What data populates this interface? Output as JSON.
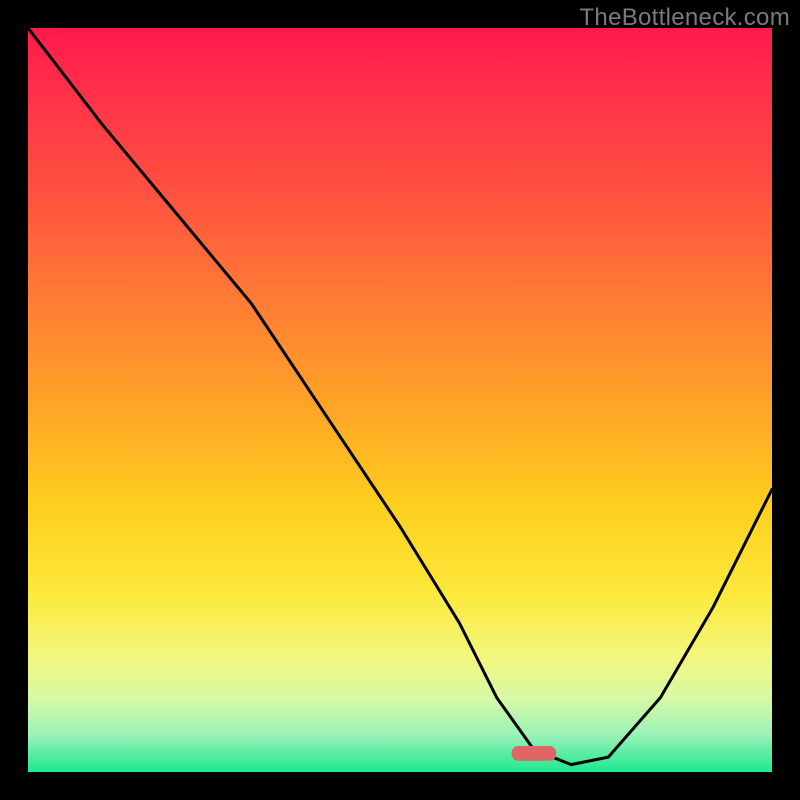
{
  "watermark": "TheBottleneck.com",
  "chart_data": {
    "type": "line",
    "title": "",
    "xlabel": "",
    "ylabel": "",
    "xlim": [
      0,
      100
    ],
    "ylim": [
      0,
      100
    ],
    "grid": false,
    "legend": false,
    "background_gradient": {
      "orientation": "vertical",
      "stops": [
        {
          "pos": 0,
          "color": "#ff1a4d"
        },
        {
          "pos": 50,
          "color": "#ffa228"
        },
        {
          "pos": 80,
          "color": "#f4f67a"
        },
        {
          "pos": 100,
          "color": "#1de890"
        }
      ]
    },
    "series": [
      {
        "name": "bottleneck-curve",
        "color": "#000000",
        "x": [
          0,
          10,
          20,
          30,
          40,
          50,
          58,
          63,
          68,
          73,
          78,
          85,
          92,
          100
        ],
        "values": [
          100,
          87,
          75,
          63,
          48,
          33,
          20,
          10,
          3,
          1,
          2,
          10,
          22,
          38
        ]
      }
    ],
    "marker": {
      "name": "optimal-marker",
      "x": 68,
      "y": 2.5,
      "color": "#e06666",
      "width_pct": 6,
      "height_pct": 2
    }
  }
}
